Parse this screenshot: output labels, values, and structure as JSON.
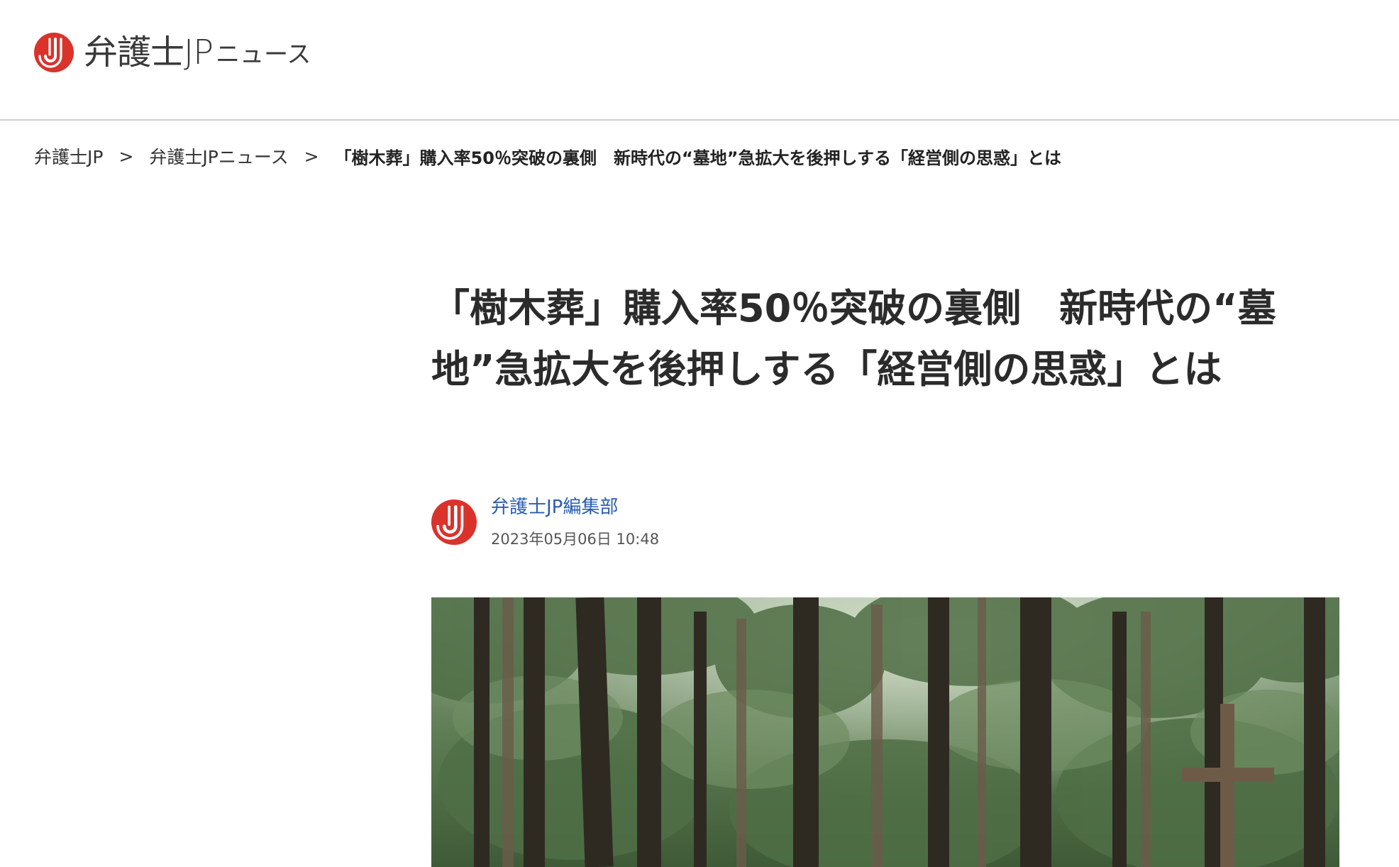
{
  "header": {
    "logo_name": "弁護士JP",
    "logo_sub": "ニュース"
  },
  "breadcrumb": {
    "items": [
      "弁護士JP",
      "弁護士JPニュース"
    ],
    "separator": ">",
    "current": "「樹木葬」購入率50％突破の裏側　新時代の“墓地”急拡大を後押しする「経営側の思惑」とは"
  },
  "article": {
    "title": "「樹木葬」購入率50％突破の裏側　新時代の“墓地”急拡大を後押しする「経営側の思惑」とは",
    "author": "弁護士JP編集部",
    "date": "2023年05月06日 10:48"
  },
  "colors": {
    "brand_red": "#d9332b",
    "link_blue": "#2a5db0",
    "divider": "#cfcfcf"
  },
  "icons": {
    "logo": "bengoshi-jp-logo-icon",
    "avatar": "author-avatar-icon"
  }
}
